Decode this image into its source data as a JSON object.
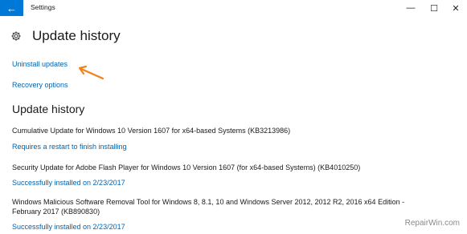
{
  "window": {
    "title": "Settings",
    "controls": {
      "minimize": "—",
      "maximize": "☐",
      "close": "✕"
    },
    "accent_color": "#0078d7"
  },
  "header": {
    "title": "Update history",
    "icon": "gear-icon"
  },
  "links": {
    "uninstall": "Uninstall updates",
    "recovery": "Recovery options"
  },
  "history": {
    "title": "Update history",
    "items": [
      {
        "name": "Cumulative Update for Windows 10 Version 1607 for x64-based Systems (KB3213986)",
        "status": "Requires a restart to finish installing"
      },
      {
        "name": "Security Update for Adobe Flash Player for Windows 10 Version 1607 (for x64-based Systems) (KB4010250)",
        "status": "Successfully installed on 2/23/2017"
      },
      {
        "name": "Windows Malicious Software Removal Tool for Windows 8, 8.1, 10 and Windows Server 2012, 2012 R2, 2016 x64 Edition - February 2017 (KB890830)",
        "status": "Successfully installed on 2/23/2017"
      }
    ]
  },
  "watermark": "RepairWin.com",
  "link_color": "#0063b1",
  "annotation_arrow_color": "#f0821e"
}
